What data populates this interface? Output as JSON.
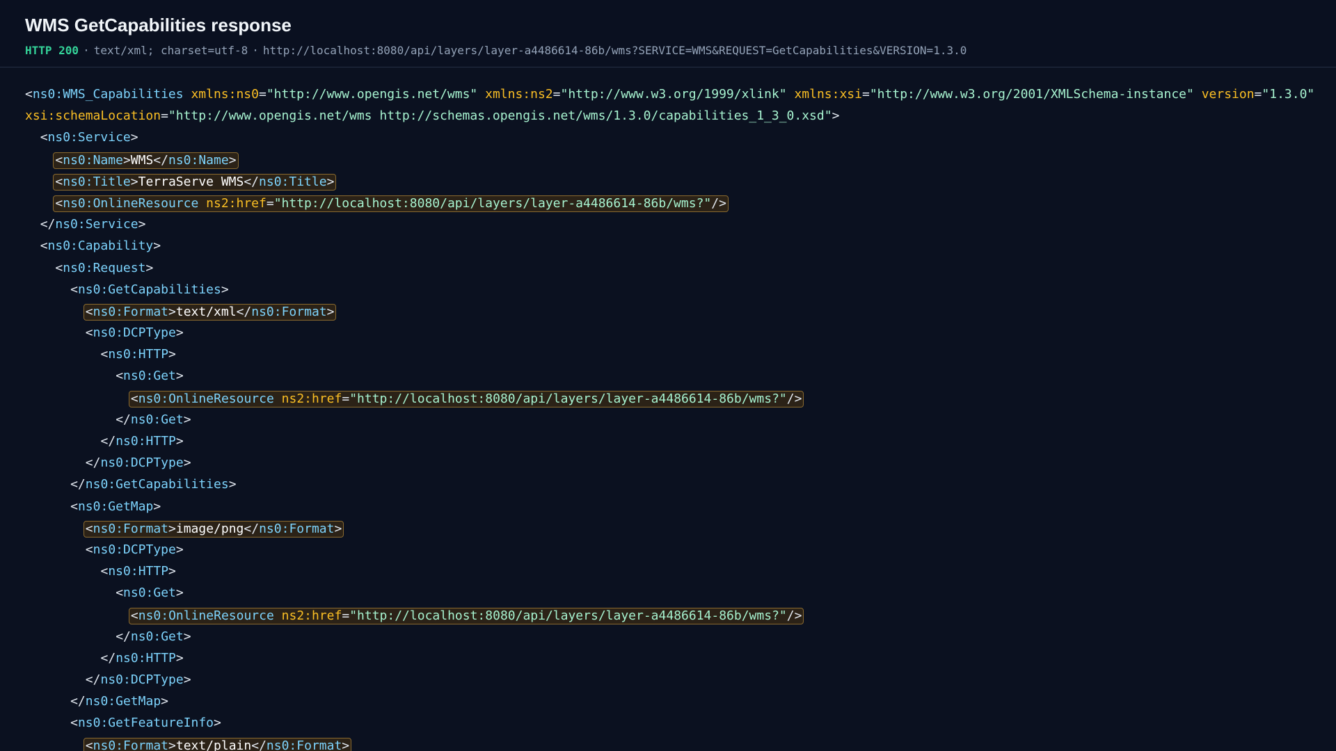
{
  "header": {
    "title": "WMS GetCapabilities response",
    "status": "HTTP 200",
    "separator": "·",
    "content_type": "text/xml; charset=utf-8",
    "url": "http://localhost:8080/api/layers/layer-a4486614-86b/wms?SERVICE=WMS&REQUEST=GetCapabilities&VERSION=1.3.0"
  },
  "xml": {
    "root_tag": "ns0:WMS_Capabilities",
    "xmlns_ns0_attr": "xmlns:ns0",
    "xmlns_ns0_val": "\"http://www.opengis.net/wms\"",
    "xmlns_ns2_attr": "xmlns:ns2",
    "xmlns_ns2_val": "\"http://www.w3.org/1999/xlink\"",
    "xmlns_xsi_attr": "xmlns:xsi",
    "xmlns_xsi_val": "\"http://www.w3.org/2001/XMLSchema-instance\"",
    "version_attr": "version",
    "version_val": "\"1.3.0\"",
    "schema_attr": "xsi:schemaLocation",
    "schema_val": "\"http://www.opengis.net/wms http://schemas.opengis.net/wms/1.3.0/capabilities_1_3_0.xsd\"",
    "service_tag": "ns0:Service",
    "name_tag": "ns0:Name",
    "name_value": "WMS",
    "title_tag": "ns0:Title",
    "title_value": "TerraServe WMS",
    "online_tag": "ns0:OnlineResource",
    "href_attr": "ns2:href",
    "href_val": "\"http://localhost:8080/api/layers/layer-a4486614-86b/wms?\"",
    "capability_tag": "ns0:Capability",
    "request_tag": "ns0:Request",
    "getcaps_tag": "ns0:GetCapabilities",
    "format_tag": "ns0:Format",
    "format_xml": "text/xml",
    "format_png": "image/png",
    "format_plain": "text/plain",
    "dcp_tag": "ns0:DCPType",
    "http_tag": "ns0:HTTP",
    "get_tag": "ns0:Get",
    "getmap_tag": "ns0:GetMap",
    "getfeatureinfo_tag": "ns0:GetFeatureInfo"
  }
}
